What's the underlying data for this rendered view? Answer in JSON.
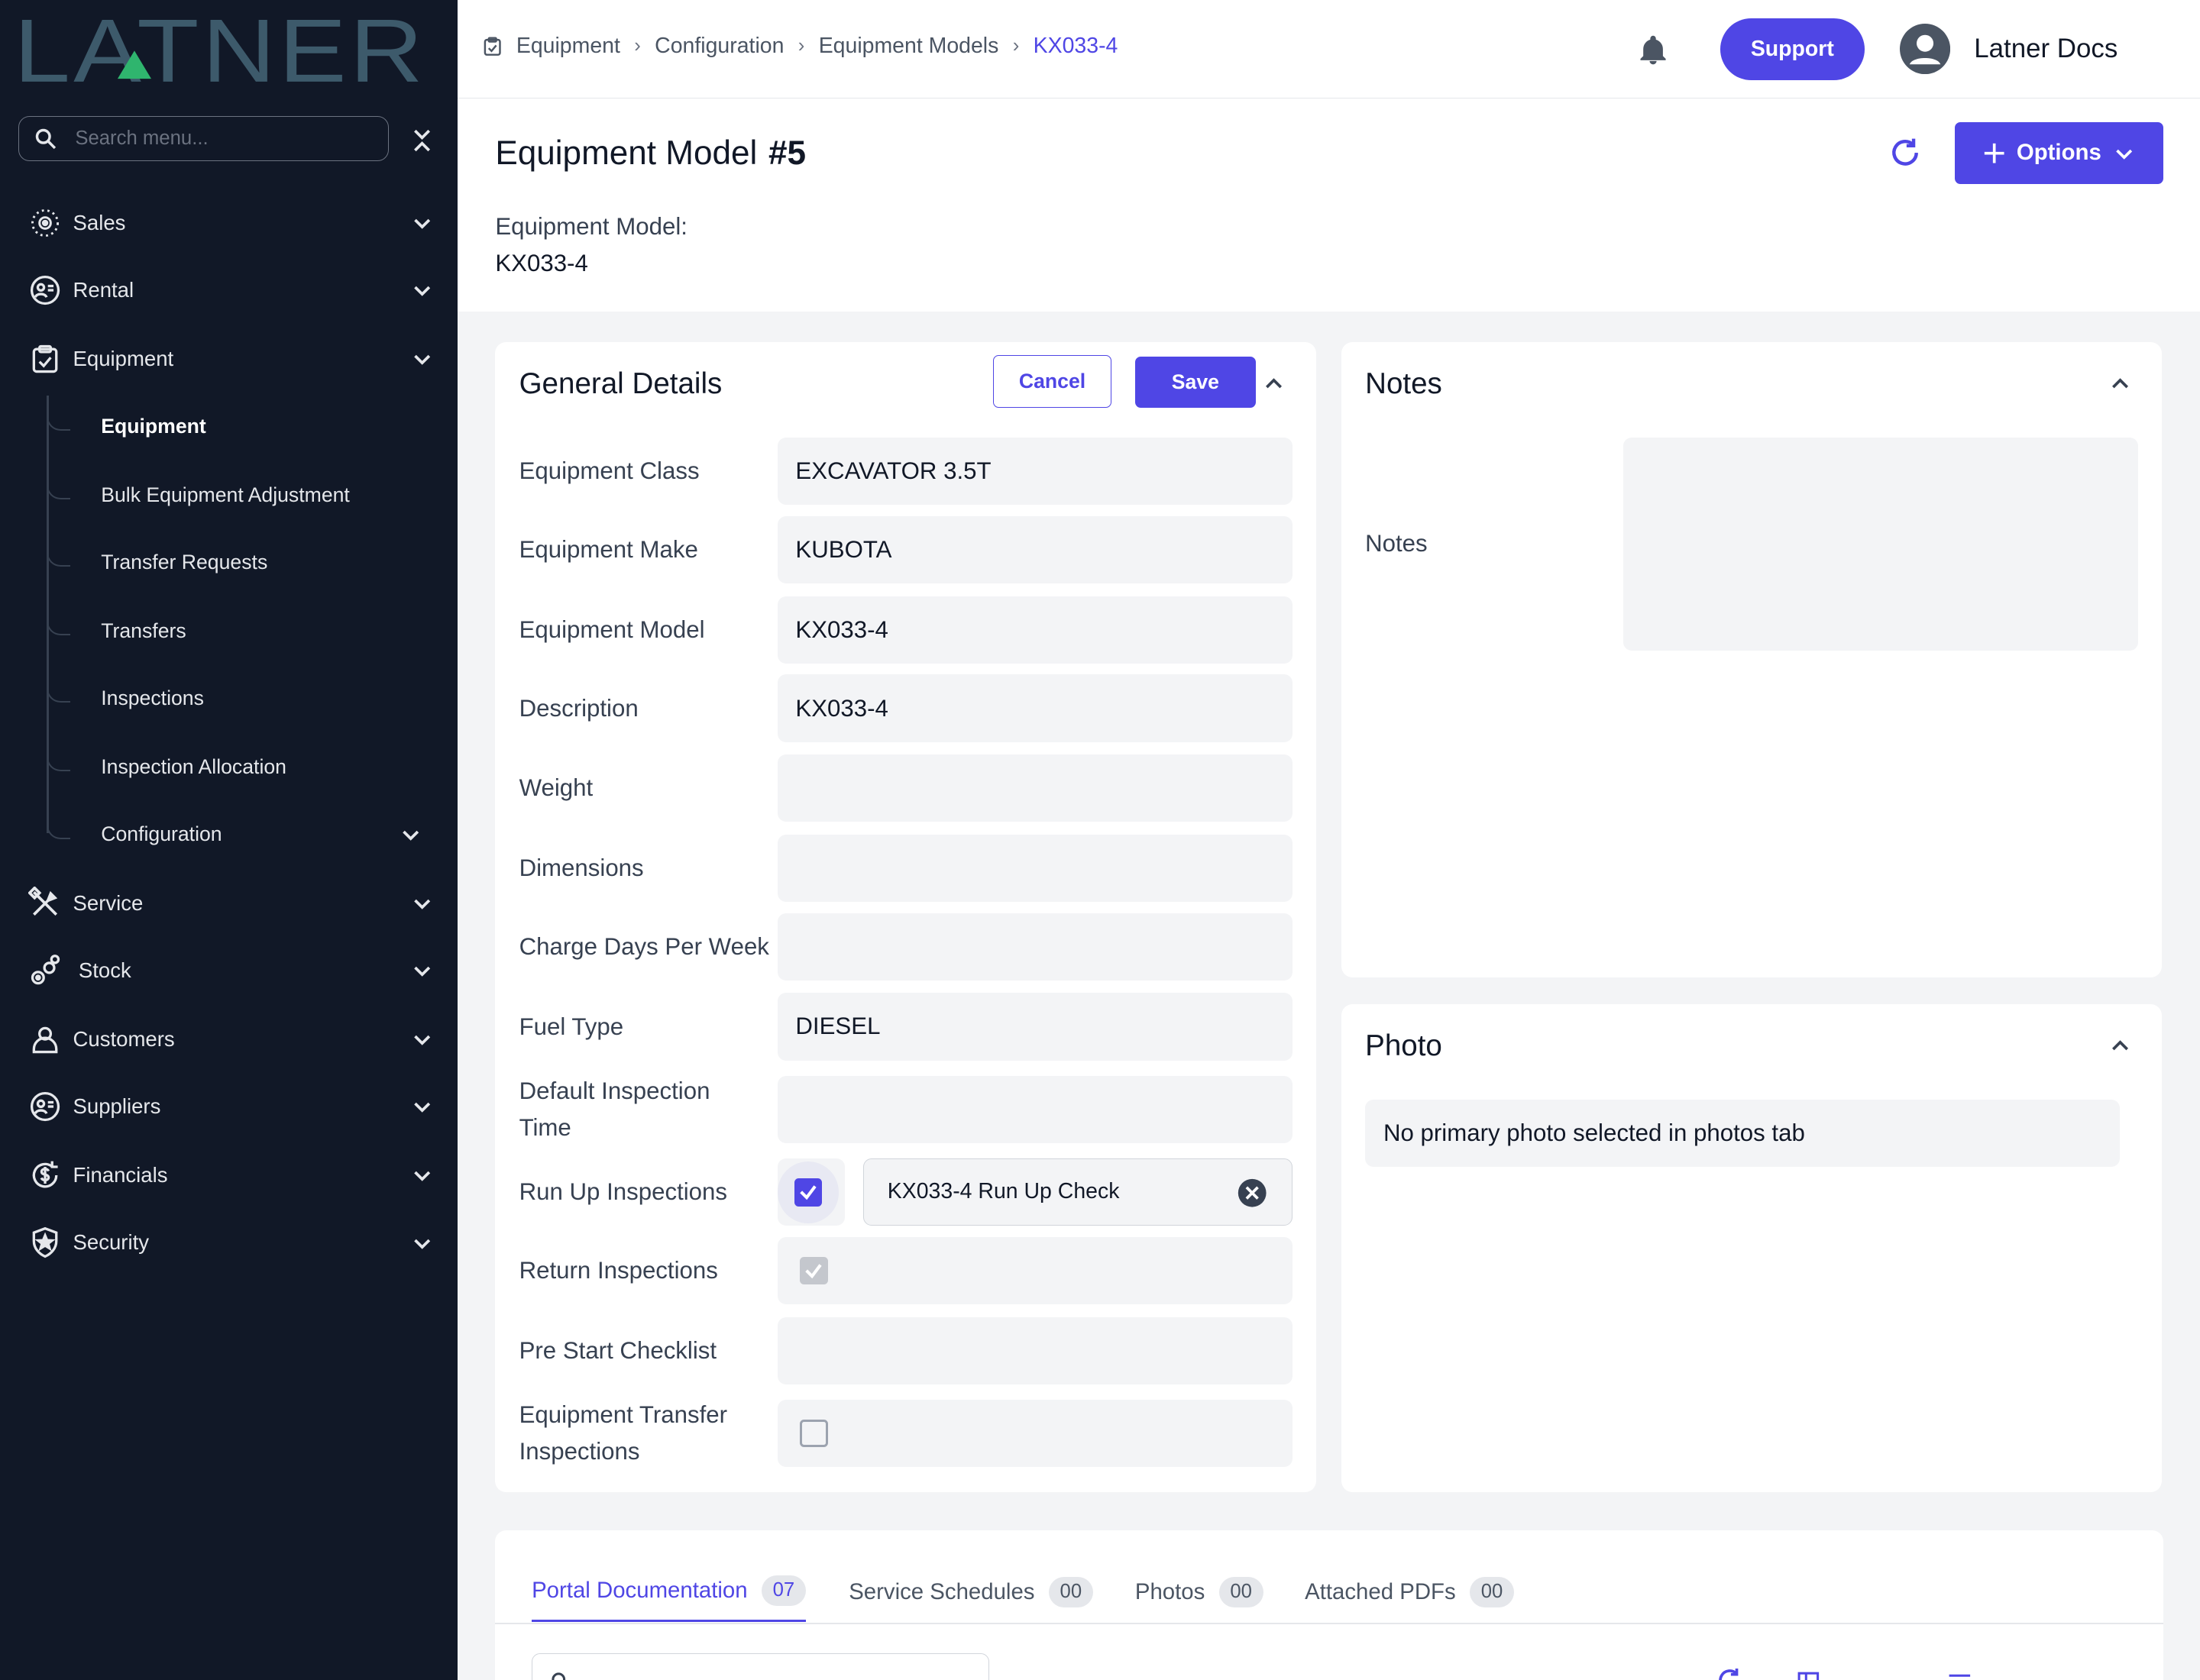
{
  "brand": {
    "logo_text": "LATNER"
  },
  "sidebar": {
    "search_placeholder": "Search menu...",
    "items": [
      {
        "label": "Sales",
        "icon": "sales-icon"
      },
      {
        "label": "Rental",
        "icon": "rental-icon"
      },
      {
        "label": "Equipment",
        "icon": "clipboard-icon"
      },
      {
        "label": "Service",
        "icon": "tools-icon"
      },
      {
        "label": "Stock",
        "icon": "stock-icon"
      },
      {
        "label": "Customers",
        "icon": "user-icon"
      },
      {
        "label": "Suppliers",
        "icon": "suppliers-icon"
      },
      {
        "label": "Financials",
        "icon": "dollar-cycle-icon"
      },
      {
        "label": "Security",
        "icon": "shield-icon"
      }
    ],
    "equipment_sub": [
      {
        "label": "Equipment"
      },
      {
        "label": "Bulk Equipment Adjustment"
      },
      {
        "label": "Transfer Requests"
      },
      {
        "label": "Transfers"
      },
      {
        "label": "Inspections"
      },
      {
        "label": "Inspection Allocation"
      },
      {
        "label": "Configuration"
      }
    ]
  },
  "topbar": {
    "breadcrumb": [
      "Equipment",
      "Configuration",
      "Equipment Models",
      "KX033-4"
    ],
    "support_label": "Support",
    "user_name": "Latner Docs"
  },
  "header": {
    "title": "Equipment Model",
    "number": "#5",
    "sub_label": "Equipment Model:",
    "sub_value": "KX033-4",
    "options_label": "Options"
  },
  "general": {
    "title": "General Details",
    "cancel_label": "Cancel",
    "save_label": "Save",
    "fields": {
      "equipment_class": {
        "label": "Equipment Class",
        "value": "EXCAVATOR 3.5T"
      },
      "equipment_make": {
        "label": "Equipment Make",
        "value": "KUBOTA"
      },
      "equipment_model": {
        "label": "Equipment Model",
        "value": "KX033-4"
      },
      "description": {
        "label": "Description",
        "value": "KX033-4"
      },
      "weight": {
        "label": "Weight",
        "value": ""
      },
      "dimensions": {
        "label": "Dimensions",
        "value": ""
      },
      "charge_days": {
        "label": "Charge Days Per Week",
        "value": ""
      },
      "fuel_type": {
        "label": "Fuel Type",
        "value": "DIESEL"
      },
      "default_inspection_time": {
        "label": "Default Inspection Time",
        "value": ""
      },
      "run_up_inspections": {
        "label": "Run Up Inspections",
        "checked": true,
        "chip": "KX033-4 Run Up Check"
      },
      "return_inspections": {
        "label": "Return Inspections",
        "checked": true
      },
      "pre_start_checklist": {
        "label": "Pre Start Checklist",
        "value": ""
      },
      "equipment_transfer_inspections": {
        "label": "Equipment Transfer Inspections",
        "checked": false
      }
    }
  },
  "notes": {
    "title": "Notes",
    "label": "Notes",
    "value": ""
  },
  "photo": {
    "title": "Photo",
    "message": "No primary photo selected in photos tab"
  },
  "tabs": [
    {
      "label": "Portal Documentation",
      "count": "07",
      "active": true
    },
    {
      "label": "Service Schedules",
      "count": "00"
    },
    {
      "label": "Photos",
      "count": "00"
    },
    {
      "label": "Attached PDFs",
      "count": "00"
    }
  ],
  "colors": {
    "accent": "#4f46e5",
    "sidebar_bg": "#111827",
    "logo": "#3d5a6b",
    "logo_accent": "#2fb56e"
  }
}
